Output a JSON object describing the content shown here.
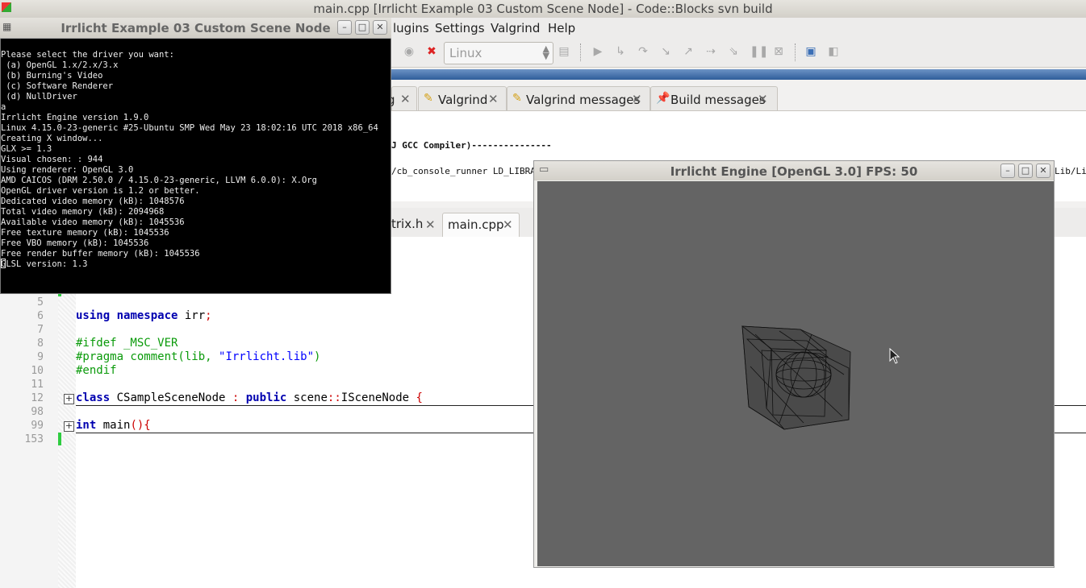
{
  "ide": {
    "title": "main.cpp [Irrlicht Example 03 Custom Scene Node] - Code::Blocks svn build",
    "menu": [
      "lugins",
      "Settings",
      "Valgrind",
      "Help"
    ],
    "target": "Linux"
  },
  "logs": {
    "tabs": [
      {
        "label": "Valgrind",
        "icon": "note-icon"
      },
      {
        "label": "Valgrind messages",
        "icon": "note-icon"
      },
      {
        "label": "Build messages",
        "icon": "pin-icon"
      }
    ],
    "partial_tab_char": "g",
    "lines": [
      "J GCC Compiler)---------------",
      "/cb_console_runner LD_LIBRARY_"
    ],
    "overflow_text": "Lib/Lin"
  },
  "editor": {
    "tabs": [
      {
        "label": "trix.h",
        "active": false
      },
      {
        "label": "main.cpp",
        "active": true
      }
    ],
    "line_numbers": [
      "5",
      "6",
      "7",
      "8",
      "9",
      "10",
      "11",
      "12",
      "98",
      "99",
      "153"
    ],
    "code": {
      "l6_using": "using",
      "l6_namespace": "namespace",
      "l6_rest": " irr",
      "l6_semi": ";",
      "l8": "#ifdef _MSC_VER",
      "l9_a": "#pragma comment(lib, ",
      "l9_str": "\"Irrlicht.lib\"",
      "l9_b": ")",
      "l10": "#endif",
      "l12_class": "class",
      "l12_name": " CSampleSceneNode ",
      "l12_colon": ":",
      "l12_public": " public",
      "l12_scene": " scene",
      "l12_dc": "::",
      "l12_base": "ISceneNode ",
      "l12_brace": "{",
      "l99_int": "int",
      "l99_main": " main",
      "l99_paren": "(){"
    }
  },
  "console": {
    "title": "Irrlicht Example 03 Custom Scene Node",
    "lines": [
      "Please select the driver you want:",
      " (a) OpenGL 1.x/2.x/3.x",
      " (b) Burning's Video",
      " (c) Software Renderer",
      " (d) NullDriver",
      "a",
      "Irrlicht Engine version 1.9.0",
      "Linux 4.15.0-23-generic #25-Ubuntu SMP Wed May 23 18:02:16 UTC 2018 x86_64",
      "Creating X window...",
      "GLX >= 1.3",
      "Visual chosen: : 944",
      "Using renderer: OpenGL 3.0",
      "AMD CAICOS (DRM 2.50.0 / 4.15.0-23-generic, LLVM 6.0.0): X.Org",
      "OpenGL driver version is 1.2 or better.",
      "Dedicated video memory (kB): 1048576",
      "Total video memory (kB): 2094968",
      "Available video memory (kB): 1045536",
      "Free texture memory (kB): 1045536",
      "Free VBO memory (kB): 1045536",
      "Free render buffer memory (kB): 1045536",
      "GLSL version: 1.3"
    ]
  },
  "irrlicht": {
    "title": "Irrlicht Engine [OpenGL 3.0] FPS: 50"
  },
  "colors": {
    "viewport_bg": "#646464",
    "accent_blue": "#2f5e9a",
    "keyword": "#0000b0",
    "preprocessor": "#0a9a0a"
  }
}
